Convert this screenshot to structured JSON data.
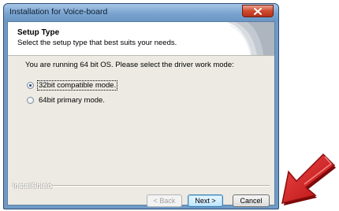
{
  "window": {
    "title": "Installation for Voice-board",
    "close_icon": "close-icon"
  },
  "header": {
    "title": "Setup Type",
    "subtitle": "Select the setup type that best suits your needs."
  },
  "main": {
    "prompt": "You are running 64 bit OS. Please select the driver work mode:",
    "options": [
      {
        "label": "32bit compatible mode.",
        "selected": true
      },
      {
        "label": "64bit primary mode.",
        "selected": false
      }
    ]
  },
  "footer": {
    "brand": "InstallShield",
    "back_label": "< Back",
    "next_label": "Next >",
    "cancel_label": "Cancel"
  },
  "colors": {
    "annotation_arrow": "#d11a1a"
  }
}
